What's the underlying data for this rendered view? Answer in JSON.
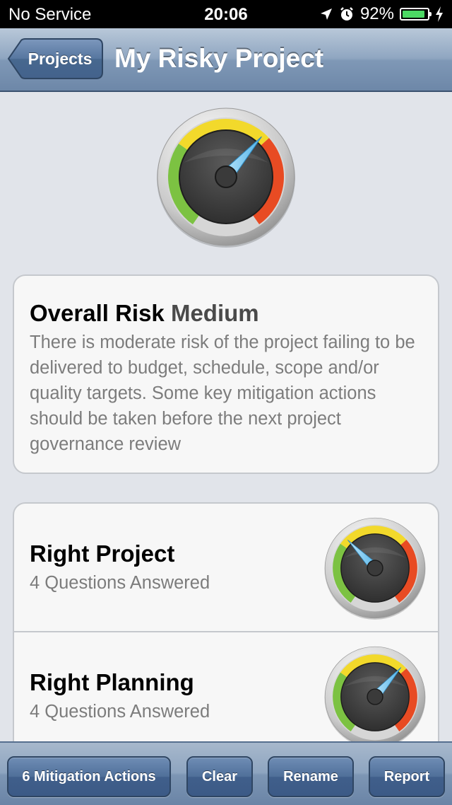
{
  "status_bar": {
    "carrier": "No Service",
    "time": "20:06",
    "battery_percent": "92%",
    "battery_level": 0.92,
    "icons": [
      "location-arrow-icon",
      "alarm-clock-icon",
      "battery-icon",
      "charging-bolt-icon"
    ]
  },
  "nav": {
    "back_label": "Projects",
    "title": "My Risky Project"
  },
  "overall": {
    "label": "Overall Risk",
    "level": "Medium",
    "description": "There is moderate risk of the project failing to be delivered to budget, schedule, scope and/or quality targets. Some key mitigation actions should be taken before the next project governance review",
    "gauge_level": 0.66
  },
  "sections": [
    {
      "title": "Right Project",
      "subtitle": "4 Questions Answered",
      "gauge_level": 0.33
    },
    {
      "title": "Right Planning",
      "subtitle": "4 Questions Answered",
      "gauge_level": 0.66
    }
  ],
  "toolbar": {
    "mitigation_label": "6 Mitigation Actions",
    "clear_label": "Clear",
    "rename_label": "Rename",
    "report_label": "Report"
  },
  "colors": {
    "gauge_green": "#7cc242",
    "gauge_yellow": "#f2d92b",
    "gauge_red": "#e84b23",
    "needle": "#4fb3e8",
    "nav_bar": "#7f98b6"
  }
}
